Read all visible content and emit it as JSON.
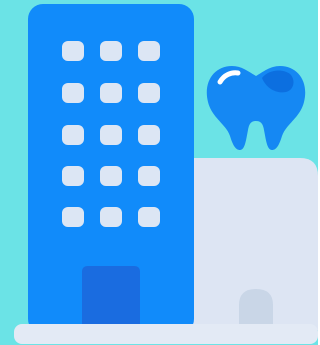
{
  "illustration": {
    "colors": {
      "background": "#6BE3E6",
      "tower": "#118BFA",
      "tower_door": "#1A6CE0",
      "window": "#DCE6F4",
      "annex": "#DDE5F3",
      "annex_door": "#C9D6E7",
      "ground": "#E3EAF5",
      "tooth": "#1588F3",
      "tooth_shade": "#0C6FE0",
      "tooth_highlight": "#FFFFFF"
    },
    "icons": {
      "building": "office-building-icon",
      "tooth": "tooth-icon"
    }
  }
}
